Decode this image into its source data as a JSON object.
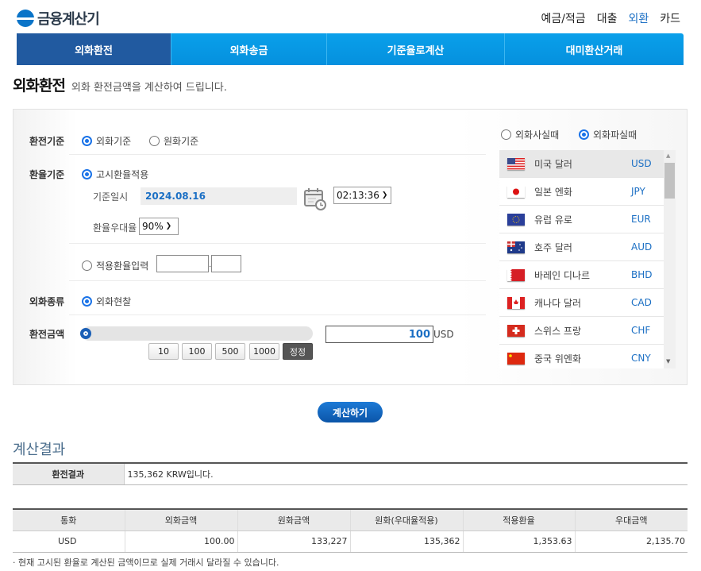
{
  "header": {
    "logo_text": "금융계산기",
    "topnav": [
      {
        "label": "예금/적금",
        "active": false
      },
      {
        "label": "대출",
        "active": false
      },
      {
        "label": "외환",
        "active": true
      },
      {
        "label": "카드",
        "active": false
      }
    ],
    "tabs": [
      {
        "label": "외화환전",
        "active": true
      },
      {
        "label": "외화송금",
        "active": false
      },
      {
        "label": "기준율로계산",
        "active": false
      },
      {
        "label": "대미환산거래",
        "active": false
      }
    ]
  },
  "page": {
    "title": "외화환전",
    "subtitle": "외화 환전금액을 계산하여 드립니다."
  },
  "form": {
    "exchange_basis": {
      "label": "환전기준",
      "options": [
        {
          "label": "외화기준",
          "checked": true
        },
        {
          "label": "원화기준",
          "checked": false
        }
      ]
    },
    "rate_basis": {
      "label": "환율기준",
      "notice_option": "고시환율적용",
      "date_label": "기준일시",
      "date_value": "2024.08.16",
      "time_value": "02:13:36",
      "pref_label": "환율우대율",
      "pref_value": "90%",
      "manual_option": "적용환율입력",
      "manual_int": "",
      "manual_dec": ""
    },
    "currency_type": {
      "label": "외화종류",
      "option": "외화현찰"
    },
    "amount": {
      "label": "환전금액",
      "slider_fraction": 0,
      "quick_buttons": [
        "10",
        "100",
        "500",
        "1000"
      ],
      "correct_button": "정정",
      "value": "100",
      "unit": "USD"
    },
    "trade_type": {
      "options": [
        {
          "label": "외화사실때",
          "checked": false
        },
        {
          "label": "외화파실때",
          "checked": true
        }
      ]
    },
    "currencies": [
      {
        "name": "미국 달러",
        "code": "USD",
        "selected": true
      },
      {
        "name": "일본 엔화",
        "code": "JPY",
        "selected": false
      },
      {
        "name": "유럽 유로",
        "code": "EUR",
        "selected": false
      },
      {
        "name": "호주 달러",
        "code": "AUD",
        "selected": false
      },
      {
        "name": "바레인 디나르",
        "code": "BHD",
        "selected": false
      },
      {
        "name": "캐나다 달러",
        "code": "CAD",
        "selected": false
      },
      {
        "name": "스위스 프랑",
        "code": "CHF",
        "selected": false
      },
      {
        "name": "중국 위엔화",
        "code": "CNY",
        "selected": false
      }
    ],
    "calc_button": "계산하기"
  },
  "result": {
    "title": "계산결과",
    "summary_label": "환전결과",
    "summary_value": "135,362 KRW입니다.",
    "columns": [
      "통화",
      "외화금액",
      "원화금액",
      "원화(우대율적용)",
      "적용환율",
      "우대금액"
    ],
    "row": [
      "USD",
      "100.00",
      "133,227",
      "135,362",
      "1,353.63",
      "2,135.70"
    ],
    "note": "· 현재 고시된 환율로 계산된 금액이므로 실제 거래시 달라질 수 있습니다."
  }
}
